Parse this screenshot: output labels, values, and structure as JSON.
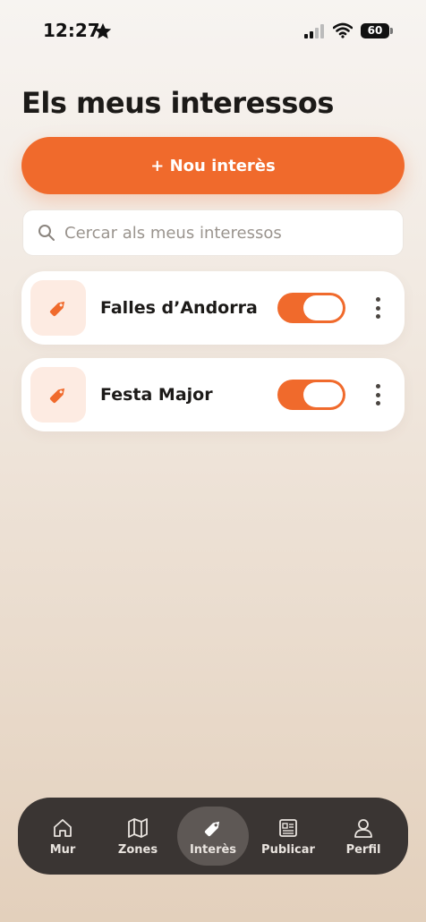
{
  "status_bar": {
    "time": "12:27",
    "battery": "60"
  },
  "page": {
    "title": "Els meus interessos"
  },
  "new_button": {
    "label": "+ Nou interès"
  },
  "search": {
    "placeholder": "Cercar als meus interessos",
    "value": ""
  },
  "interests": [
    {
      "label": "Falles d’Andorra",
      "enabled": true
    },
    {
      "label": "Festa Major",
      "enabled": true
    }
  ],
  "tabbar": {
    "items": [
      {
        "label": "Mur",
        "icon": "home-icon"
      },
      {
        "label": "Zones",
        "icon": "map-icon"
      },
      {
        "label": "Interès",
        "icon": "tag-icon",
        "active": true
      },
      {
        "label": "Publicar",
        "icon": "newspaper-icon"
      },
      {
        "label": "Perfil",
        "icon": "user-icon"
      }
    ]
  },
  "colors": {
    "accent": "#f06a2c",
    "tabbar_bg": "#3a3533",
    "icon_bg": "#fdebe2"
  }
}
